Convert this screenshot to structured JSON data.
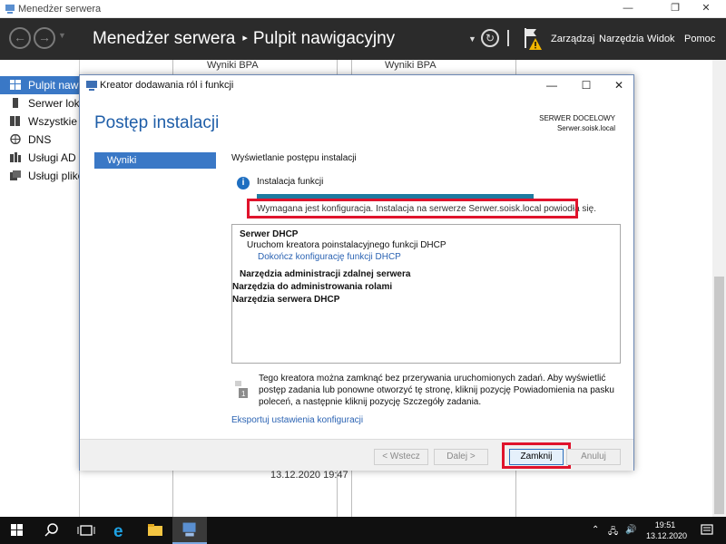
{
  "window": {
    "title": "Menedżer serwera",
    "minimize": "—",
    "restore": "❐",
    "close": "✕"
  },
  "header": {
    "app_name": "Menedżer serwera",
    "separator": "▸",
    "page_name": "Pulpit nawigacyjny",
    "menus": [
      "Zarządzaj",
      "Narzędzia",
      "Widok",
      "Pomoc"
    ]
  },
  "sidebar": {
    "items": [
      {
        "label": "Pulpit nawigacyjny",
        "icon": "dashboard-icon"
      },
      {
        "label": "Serwer lokalny",
        "icon": "server-icon"
      },
      {
        "label": "Wszystkie serwery",
        "icon": "servers-icon"
      },
      {
        "label": "DNS",
        "icon": "dns-icon"
      },
      {
        "label": "Usługi AD DS",
        "icon": "ad-icon"
      },
      {
        "label": "Usługi plików",
        "icon": "file-services-icon"
      }
    ]
  },
  "background": {
    "tiles": [
      "Wyniki BPA",
      "Wyniki BPA"
    ],
    "timestamp": "13.12.2020 19:47"
  },
  "dialog": {
    "title": "Kreator dodawania ról i funkcji",
    "heading": "Postęp instalacji",
    "destination_label": "SERWER DOCELOWY",
    "destination_server": "Serwer.soisk.local",
    "nav_item": "Wyniki",
    "section_title": "Wyświetlanie postępu instalacji",
    "status": "Instalacja funkcji",
    "progress_percent": 100,
    "result_message": "Wymagana jest konfiguracja. Instalacja na serwerze Serwer.soisk.local powiodła się.",
    "results": [
      {
        "text": "Serwer DHCP",
        "style": "b",
        "indent": 0
      },
      {
        "text": "Uruchom kreatora poinstalacyjnego funkcji DHCP",
        "style": "",
        "indent": 1
      },
      {
        "text": "Dokończ konfigurację funkcji DHCP",
        "style": "link",
        "indent": 2
      },
      {
        "text": "Narzędzia administracji zdalnej serwera",
        "style": "b",
        "indent": 0
      },
      {
        "text": "Narzędzia do administrowania rolami",
        "style": "b",
        "indent": 3
      },
      {
        "text": "Narzędzia serwera DHCP",
        "style": "b",
        "indent": 5
      }
    ],
    "note": "Tego kreatora można zamknąć bez przerywania uruchomionych zadań. Aby wyświetlić postęp zadania lub ponowne otworzyć tę stronę, kliknij pozycję Powiadomienia na pasku poleceń, a następnie kliknij pozycję Szczegóły zadania.",
    "export_link": "Eksportuj ustawienia konfiguracji",
    "buttons": {
      "back": "< Wstecz",
      "next": "Dalej >",
      "close": "Zamknij",
      "cancel": "Anuluj"
    },
    "highlight_color": "#e0132c"
  },
  "taskbar": {
    "time": "19:51",
    "date": "13.12.2020"
  }
}
